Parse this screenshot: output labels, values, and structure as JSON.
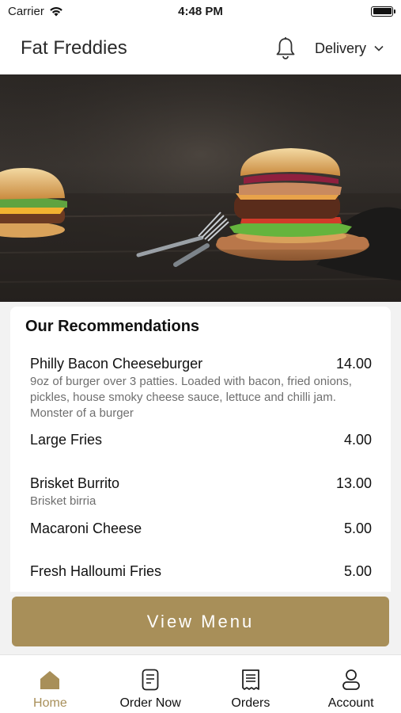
{
  "status_bar": {
    "carrier": "Carrier",
    "time": "4:48 PM"
  },
  "header": {
    "title": "Fat Freddies",
    "delivery_label": "Delivery"
  },
  "recommendations": {
    "title": "Our Recommendations",
    "items": [
      {
        "name": "Philly Bacon Cheeseburger",
        "price": "14.00",
        "description": "9oz of burger over 3 patties. Loaded with bacon, fried onions, pickles, house smoky cheese sauce, lettuce and chilli jam. Monster of a burger"
      },
      {
        "name": "Large Fries",
        "price": "4.00",
        "description": ""
      },
      {
        "name": "Brisket Burrito",
        "price": "13.00",
        "description": "Brisket birria"
      },
      {
        "name": "Macaroni Cheese",
        "price": "5.00",
        "description": ""
      },
      {
        "name": "Fresh Halloumi Fries",
        "price": "5.00",
        "description": ""
      }
    ]
  },
  "view_menu_label": "View Menu",
  "bottom_nav": {
    "active_color": "#a88f59",
    "items": [
      {
        "label": "Home",
        "icon": "home-icon",
        "active": true
      },
      {
        "label": "Order Now",
        "icon": "order-icon",
        "active": false
      },
      {
        "label": "Orders",
        "icon": "receipt-icon",
        "active": false
      },
      {
        "label": "Account",
        "icon": "account-icon",
        "active": false
      }
    ]
  }
}
